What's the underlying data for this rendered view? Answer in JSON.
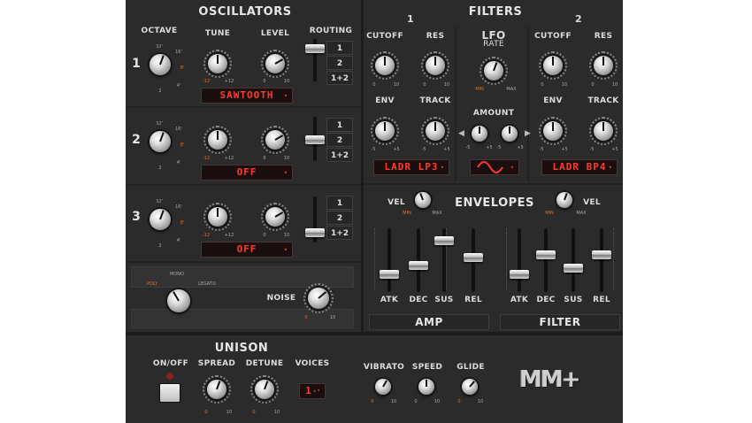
{
  "oscillators": {
    "title": "OSCILLATORS",
    "labels": {
      "octave": "OCTAVE",
      "tune": "TUNE",
      "level": "LEVEL",
      "routing": "ROUTING"
    },
    "octave_marks": [
      "32'",
      "16'",
      "8'",
      "4'",
      "2"
    ],
    "tune_marks": [
      "-12",
      "+12"
    ],
    "level_marks": [
      "0",
      "10"
    ],
    "routing_options": [
      "1",
      "2",
      "1+2"
    ],
    "osc": [
      {
        "number": "1",
        "waveform": "SAWTOOTH"
      },
      {
        "number": "2",
        "waveform": "OFF"
      },
      {
        "number": "3",
        "waveform": "OFF"
      }
    ]
  },
  "voice_mode": {
    "options": [
      "POLY",
      "MONO",
      "LEGATO"
    ]
  },
  "noise": {
    "label": "NOISE",
    "marks": [
      "0",
      "10"
    ]
  },
  "filters": {
    "title": "FILTERS",
    "filter1": {
      "number": "1",
      "cutoff": "CUTOFF",
      "res": "RES",
      "env": "ENV",
      "track": "TRACK",
      "mode": "LADR LP3",
      "marks_a": [
        "0",
        "10"
      ],
      "marks_b": [
        "-5",
        "+5"
      ]
    },
    "filter2": {
      "number": "2",
      "cutoff": "CUTOFF",
      "res": "RES",
      "env": "ENV",
      "track": "TRACK",
      "mode": "LADR BP4",
      "marks_a": [
        "0",
        "10"
      ],
      "marks_b": [
        "-5",
        "+5"
      ]
    },
    "lfo": {
      "title": "LFO",
      "rate": "RATE",
      "amount": "AMOUNT",
      "min": "MIN",
      "max": "MAX",
      "amt_marks": [
        "-5",
        "+5",
        "-5",
        "+5"
      ]
    }
  },
  "envelopes": {
    "title": "ENVELOPES",
    "vel": "VEL",
    "vel_marks": [
      "MIN",
      "MAX"
    ],
    "amp": {
      "label": "AMP",
      "sliders": [
        "ATK",
        "DEC",
        "SUS",
        "REL"
      ],
      "levels": [
        0.25,
        0.4,
        0.85,
        0.55
      ]
    },
    "filter": {
      "label": "FILTER",
      "sliders": [
        "ATK",
        "DEC",
        "SUS",
        "REL"
      ],
      "levels": [
        0.25,
        0.6,
        0.35,
        0.6
      ]
    }
  },
  "unison": {
    "title": "UNISON",
    "on_off": "ON/OFF",
    "spread": "SPREAD",
    "detune": "DETUNE",
    "voices": "VOICES",
    "voices_value": "1",
    "marks": [
      "0",
      "10"
    ]
  },
  "global": {
    "vibrato": "VIBRATO",
    "speed": "SPEED",
    "glide": "GLIDE",
    "marks": [
      "0",
      "10"
    ]
  },
  "brand": {
    "logo": "MM+"
  }
}
